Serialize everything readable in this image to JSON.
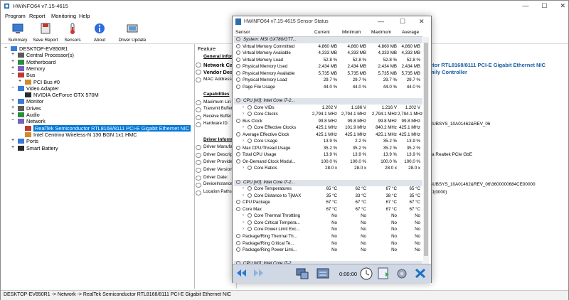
{
  "app": {
    "title": "HWiNFO64 v7.15-4615"
  },
  "menu": [
    "Program",
    "Report",
    "Monitoring",
    "Help"
  ],
  "toolbar": [
    {
      "label": "Summary",
      "icon": "summary-icon"
    },
    {
      "label": "Save Report",
      "icon": "save-icon"
    },
    {
      "label": "Sensors",
      "icon": "sensors-icon"
    },
    {
      "label": "About",
      "icon": "about-icon"
    },
    {
      "label": "Driver Update",
      "icon": "driver-update-icon"
    }
  ],
  "tree": [
    {
      "label": "DESKTOP-EV850R1",
      "toggle": "−",
      "indent": 0,
      "icon": "computer-icon"
    },
    {
      "label": "Central Processor(s)",
      "toggle": "+",
      "indent": 1,
      "icon": "cpu-icon"
    },
    {
      "label": "Motherboard",
      "toggle": "+",
      "indent": 1,
      "icon": "motherboard-icon"
    },
    {
      "label": "Memory",
      "toggle": "+",
      "indent": 1,
      "icon": "memory-icon"
    },
    {
      "label": "Bus",
      "toggle": "−",
      "indent": 1,
      "icon": "bus-icon"
    },
    {
      "label": "PCI Bus #0",
      "toggle": "+",
      "indent": 2,
      "icon": "pci-icon"
    },
    {
      "label": "Video Adapter",
      "toggle": "−",
      "indent": 1,
      "icon": "video-icon"
    },
    {
      "label": "NVIDIA GeForce GTX 570M",
      "toggle": "",
      "indent": 2,
      "icon": "gpu-icon"
    },
    {
      "label": "Monitor",
      "toggle": "+",
      "indent": 1,
      "icon": "monitor-icon"
    },
    {
      "label": "Drives",
      "toggle": "+",
      "indent": 1,
      "icon": "drive-icon"
    },
    {
      "label": "Audio",
      "toggle": "+",
      "indent": 1,
      "icon": "audio-icon"
    },
    {
      "label": "Network",
      "toggle": "−",
      "indent": 1,
      "icon": "network-icon"
    },
    {
      "label": "RealTek Semiconductor RTL8168/8111 PCI-E Gigabit Ethernet NIC",
      "toggle": "",
      "indent": 2,
      "icon": "nic-icon",
      "selected": true
    },
    {
      "label": "Intel Centrino Wireless-N 130 BGN 1x1 HMC",
      "toggle": "",
      "indent": 2,
      "icon": "wifi-icon"
    },
    {
      "label": "Ports",
      "toggle": "+",
      "indent": 1,
      "icon": "ports-icon"
    },
    {
      "label": "Smart Battery",
      "toggle": "+",
      "indent": 1,
      "icon": "battery-icon"
    }
  ],
  "details": {
    "feature_header": "Feature",
    "rows": [
      {
        "text": "General inform",
        "style": "section"
      },
      {
        "text": "Network Ca",
        "style": "bold"
      },
      {
        "text": "Vendor Desc",
        "style": "bold"
      },
      {
        "text": "MAC Address",
        "style": "plain"
      },
      {
        "text": "",
        "style": "gap"
      },
      {
        "text": "Capabilities",
        "style": "section"
      },
      {
        "text": "Maximum Lin",
        "style": "plain"
      },
      {
        "text": "Transmit Buffer",
        "style": "small"
      },
      {
        "text": "Receive Buffer S",
        "style": "small"
      },
      {
        "text": "Hardware ID:",
        "style": "small"
      },
      {
        "text": "",
        "style": "gap"
      },
      {
        "text": "Driver Informa",
        "style": "section"
      },
      {
        "text": "Driver Manufa",
        "style": "plain"
      },
      {
        "text": "Driver Descrip",
        "style": "plain"
      },
      {
        "text": "Driver Provide",
        "style": "plain"
      },
      {
        "text": "Driver Version",
        "style": "plain"
      },
      {
        "text": "Driver Date:",
        "style": "plain"
      },
      {
        "text": "DeviceInstance",
        "style": "small"
      },
      {
        "text": "Location Paths",
        "style": "small"
      }
    ],
    "right_values": [
      {
        "text": "ctor RTL8168/8111 PCI-E Gigabit Ethernet NIC",
        "style": "bigblue",
        "row": 1
      },
      {
        "text": "mily Controller",
        "style": "bigblue",
        "row": 2
      },
      {
        "text": "SUBSYS_10A01462&REV_06",
        "style": "small",
        "row": 9
      },
      {
        "text": "sa Realtek PCIe GbE",
        "style": "small",
        "row": 13
      },
      {
        "text": "SUBSYS_10A01462&REV_06\\3600000684CE00000",
        "style": "small",
        "row": 17
      },
      {
        "text": "CI(0000)",
        "style": "small",
        "row": 18
      }
    ]
  },
  "status_text": "DESKTOP-EV850R1 -> Network -> RealTek Semiconductor RTL8168/8111 PCI-E Gigabit Ethernet NIC",
  "sensor_window": {
    "title": "HWiNFO64 v7.15-4615 Sensor Status",
    "columns": [
      "Sensor",
      "Current",
      "Minimum",
      "Maximum",
      "Average"
    ],
    "timer": "0:00:00",
    "rows": [
      {
        "type": "group",
        "name": "System: MSI GX780/GT7..."
      },
      {
        "type": "row",
        "name": "Virtual Memory Committed",
        "v": [
          "4,860 MB",
          "4,860 MB",
          "4,860 MB",
          "4,860 MB"
        ]
      },
      {
        "type": "row",
        "name": "Virtual Memory Available",
        "v": [
          "4,333 MB",
          "4,333 MB",
          "4,333 MB",
          "4,333 MB"
        ]
      },
      {
        "type": "row",
        "name": "Virtual Memory Load",
        "v": [
          "52.8 %",
          "52.8 %",
          "52.8 %",
          "52.8 %"
        ]
      },
      {
        "type": "row",
        "name": "Physical Memory Used",
        "v": [
          "2,434 MB",
          "2,434 MB",
          "2,434 MB",
          "2,434 MB"
        ]
      },
      {
        "type": "row",
        "name": "Physical Memory Available",
        "v": [
          "5,735 MB",
          "5,735 MB",
          "5,735 MB",
          "5,735 MB"
        ]
      },
      {
        "type": "row",
        "name": "Physical Memory Load",
        "v": [
          "29.7 %",
          "29.7 %",
          "29.7 %",
          "29.7 %"
        ]
      },
      {
        "type": "row",
        "name": "Page File Usage",
        "v": [
          "44.0 %",
          "44.0 %",
          "44.0 %",
          "44.0 %"
        ]
      },
      {
        "type": "blank"
      },
      {
        "type": "group",
        "name": "CPU [#0]: Intel Core i7-2..."
      },
      {
        "type": "row",
        "chev": true,
        "name": "Core VIDs",
        "v": [
          "1.202 V",
          "1.186 V",
          "1.216 V",
          "1.202 V"
        ]
      },
      {
        "type": "row",
        "chev": true,
        "name": "Core Clocks",
        "v": [
          "2,794.1 MHz",
          "2,794.1 MHz",
          "2,794.1 MHz",
          "2,794.1 MHz"
        ]
      },
      {
        "type": "row",
        "name": "Bus Clock",
        "v": [
          "99.8 MHz",
          "99.8 MHz",
          "99.8 MHz",
          "99.8 MHz"
        ]
      },
      {
        "type": "row",
        "chev": true,
        "name": "Core Effective Clocks",
        "v": [
          "425.1 MHz",
          "101.9 MHz",
          "840.2 MHz",
          "425.1 MHz"
        ]
      },
      {
        "type": "row",
        "name": "Average Effective Clock",
        "v": [
          "425.1 MHz",
          "425.1 MHz",
          "425.1 MHz",
          "425.1 MHz"
        ]
      },
      {
        "type": "row",
        "chev": true,
        "name": "Core Usage",
        "v": [
          "13.9 %",
          "2.2 %",
          "35.2 %",
          "13.9 %"
        ]
      },
      {
        "type": "row",
        "name": "Max CPU/Thread Usage",
        "v": [
          "35.2 %",
          "35.2 %",
          "35.2 %",
          "35.2 %"
        ]
      },
      {
        "type": "row",
        "name": "Total CPU Usage",
        "v": [
          "13.9 %",
          "13.9 %",
          "13.9 %",
          "13.9 %"
        ]
      },
      {
        "type": "row",
        "name": "On-Demand Clock Modul...",
        "v": [
          "100.0 %",
          "100.0 %",
          "100.0 %",
          "100.0 %"
        ]
      },
      {
        "type": "row",
        "chev": true,
        "name": "Core Ratios",
        "v": [
          "28.0 x",
          "28.0 x",
          "28.0 x",
          "28.0 x"
        ]
      },
      {
        "type": "blank"
      },
      {
        "type": "group",
        "name": "CPU [#0]: Intel Core i7-2..."
      },
      {
        "type": "row",
        "chev": true,
        "name": "Core Temperatures",
        "v": [
          "65 °C",
          "62 °C",
          "67 °C",
          "65 °C"
        ]
      },
      {
        "type": "row",
        "chev": true,
        "name": "Core Distance to TjMAX",
        "v": [
          "35 °C",
          "33 °C",
          "38 °C",
          "35 °C"
        ]
      },
      {
        "type": "row",
        "name": "CPU Package",
        "v": [
          "67 °C",
          "67 °C",
          "67 °C",
          "67 °C"
        ]
      },
      {
        "type": "row",
        "name": "Core Max",
        "v": [
          "67 °C",
          "67 °C",
          "67 °C",
          "67 °C"
        ]
      },
      {
        "type": "row",
        "chev": true,
        "name": "Core Thermal Throttling",
        "v": [
          "No",
          "No",
          "No",
          "No"
        ]
      },
      {
        "type": "row",
        "chev": true,
        "name": "Core Critical Tempera...",
        "v": [
          "No",
          "No",
          "No",
          "No"
        ]
      },
      {
        "type": "row",
        "chev": true,
        "name": "Core Power Limit Exc...",
        "v": [
          "No",
          "No",
          "No",
          "No"
        ]
      },
      {
        "type": "row",
        "name": "Package/Ring Thermal Th...",
        "v": [
          "No",
          "No",
          "No",
          "No"
        ]
      },
      {
        "type": "row",
        "name": "Package/Ring Critical Te...",
        "v": [
          "No",
          "No",
          "No",
          "No"
        ]
      },
      {
        "type": "row",
        "name": "Package/Ring Power Limi...",
        "v": [
          "No",
          "No",
          "No",
          "No"
        ]
      },
      {
        "type": "blank"
      },
      {
        "type": "group",
        "name": "CPU [#0]: Intel Core i7-2..."
      }
    ]
  },
  "colors": {
    "selection": "#0078d7",
    "link_blue": "#1a5ea6",
    "footer": "#cfd8e4",
    "group_row": "#dfe3ea"
  }
}
